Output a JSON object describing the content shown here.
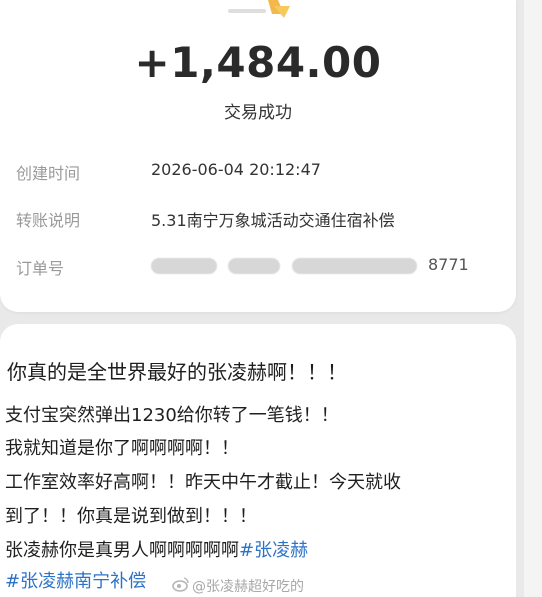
{
  "receipt": {
    "amount": "+1,484.00",
    "status": "交易成功",
    "created_label": "创建时间",
    "created_value": "2026-06-04 20:12:47",
    "note_label": "转账说明",
    "note_value": "5.31南宁万象城活动交通住宿补偿",
    "order_label": "订单号",
    "order_visible_suffix": "8771"
  },
  "post": {
    "title": "你真的是全世界最好的张凌赫啊！！！",
    "line1": "支付宝突然弹出1230给你转了一笔钱！！",
    "line2": "我就知道是你了啊啊啊啊！！",
    "line3": "工作室效率好高啊！！昨天中午才截止！今天就收",
    "line4": "到了！！你真是说到做到！！！",
    "line5_text": "张凌赫你是真男人啊啊啊啊啊",
    "line5_tag": "#张凌赫",
    "line6_tag": "#张凌赫南宁补偿"
  },
  "watermark": {
    "text": "@张凌赫超好吃的"
  },
  "colors": {
    "tag": "#2c73c8",
    "text": "#1f1f1f",
    "label": "#9a9a9a"
  },
  "icons": {
    "logo": "alipay-logo-icon",
    "watermark": "weibo-icon"
  }
}
